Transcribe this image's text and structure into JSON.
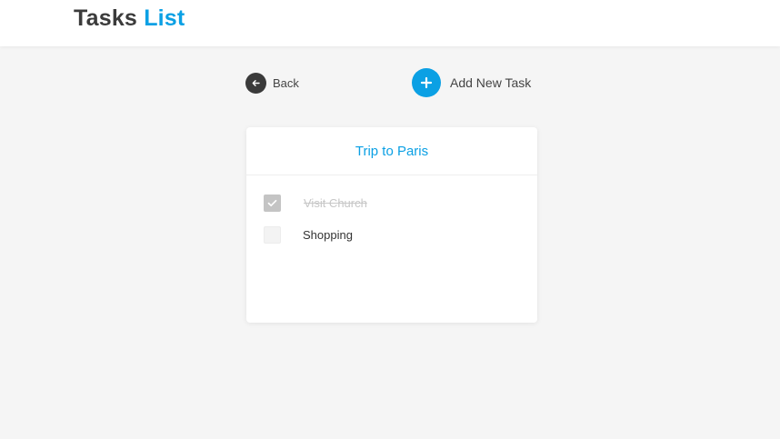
{
  "header": {
    "brand_primary": "Tasks",
    "brand_accent": "List"
  },
  "toolbar": {
    "back_label": "Back",
    "add_label": "Add New Task"
  },
  "list": {
    "title": "Trip to Paris",
    "tasks": [
      {
        "label": "Visit Church",
        "done": true
      },
      {
        "label": "Shopping",
        "done": false
      }
    ]
  },
  "colors": {
    "accent": "#0ba0e4",
    "text_dark": "#3b3b3b",
    "background": "#f5f5f5",
    "checked": "#c4c4c4"
  },
  "icons": {
    "back": "arrow-left-icon",
    "add": "plus-icon",
    "check": "check-icon"
  }
}
